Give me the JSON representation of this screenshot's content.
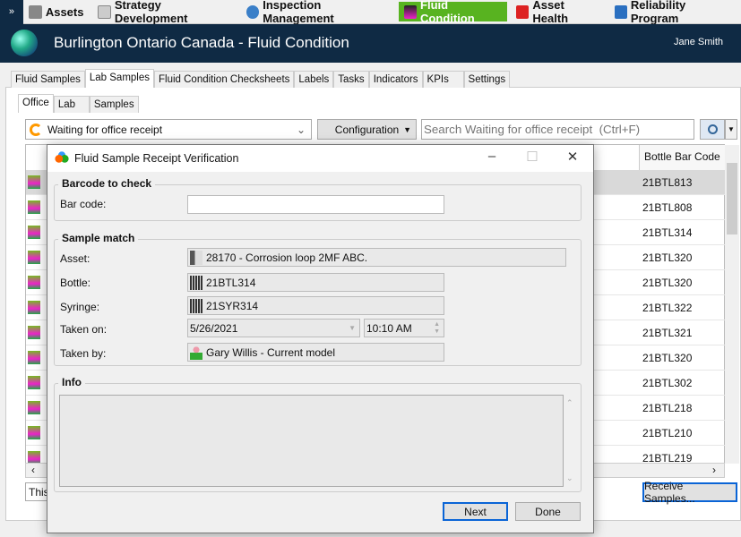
{
  "nav": {
    "items": [
      {
        "label": "Assets"
      },
      {
        "label": "Strategy Development"
      },
      {
        "label": "Inspection Management"
      },
      {
        "label": "Fluid Condition",
        "active": true
      },
      {
        "label": "Asset Health"
      },
      {
        "label": "Reliability Program"
      }
    ]
  },
  "header": {
    "title": "Burlington Ontario Canada - Fluid Condition",
    "user": "Jane Smith"
  },
  "tabs": [
    "Fluid Samples",
    "Lab Samples",
    "Fluid Condition Checksheets",
    "Labels",
    "Tasks",
    "Indicators",
    "KPIs",
    "Settings"
  ],
  "subtabs": [
    "Office",
    "Lab",
    "Samples"
  ],
  "toolbar": {
    "view": "Waiting for office receipt",
    "configuration": "Configuration",
    "search_placeholder": "Search Waiting for office receipt  (Ctrl+F)"
  },
  "grid": {
    "column": "Bottle Bar Code",
    "rows": [
      "21BTL813",
      "21BTL808",
      "21BTL314",
      "21BTL320",
      "21BTL320",
      "21BTL322",
      "21BTL321",
      "21BTL320",
      "21BTL302",
      "21BTL218",
      "21BTL210",
      "21BTL219"
    ]
  },
  "status": {
    "text": "This",
    "receive": "Receive Samples..."
  },
  "dialog": {
    "title": "Fluid Sample Receipt Verification",
    "barcode_group": "Barcode to check",
    "barcode_label": "Bar code:",
    "barcode_value": "",
    "match_group": "Sample match",
    "asset_label": "Asset:",
    "asset": "28170 - Corrosion loop 2MF ABC.",
    "bottle_label": "Bottle:",
    "bottle": "21BTL314",
    "syringe_label": "Syringe:",
    "syringe": "21SYR314",
    "taken_on_label": "Taken on:",
    "date": "5/26/2021",
    "time": "10:10 AM",
    "taken_by_label": "Taken by:",
    "taken_by": "Gary Willis - Current model",
    "info_group": "Info",
    "next": "Next",
    "done": "Done"
  },
  "colors": {
    "accent": "#58b320",
    "header": "#0f2a44",
    "focus": "#0a64d6"
  }
}
